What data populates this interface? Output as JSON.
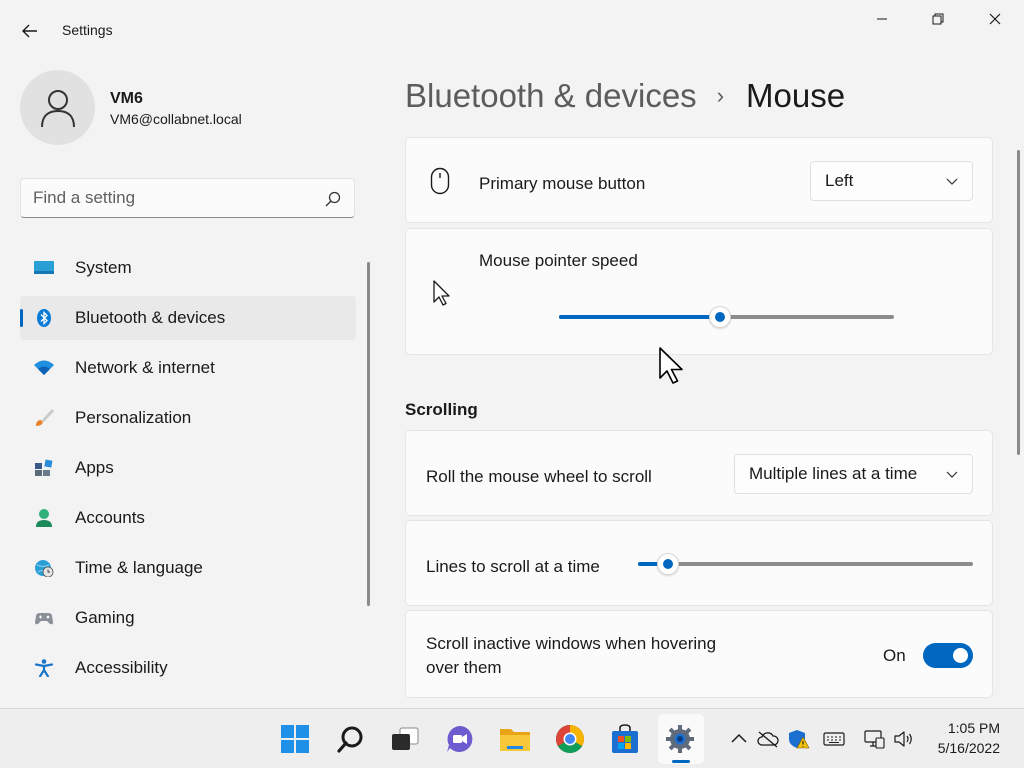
{
  "window": {
    "title": "Settings",
    "back_icon": "back-arrow-icon",
    "minimize_icon": "minimize-icon",
    "maximize_icon": "restore-icon",
    "close_icon": "close-icon"
  },
  "user": {
    "name": "VM6",
    "email": "VM6@collabnet.local",
    "avatar_icon": "person-icon"
  },
  "search": {
    "placeholder": "Find a setting",
    "icon": "search-icon"
  },
  "sidebar": {
    "items": [
      {
        "label": "System",
        "icon": "system-icon",
        "active": false
      },
      {
        "label": "Bluetooth & devices",
        "icon": "bluetooth-icon",
        "active": true
      },
      {
        "label": "Network & internet",
        "icon": "wifi-icon",
        "active": false
      },
      {
        "label": "Personalization",
        "icon": "brush-icon",
        "active": false
      },
      {
        "label": "Apps",
        "icon": "apps-icon",
        "active": false
      },
      {
        "label": "Accounts",
        "icon": "accounts-icon",
        "active": false
      },
      {
        "label": "Time & language",
        "icon": "globe-clock-icon",
        "active": false
      },
      {
        "label": "Gaming",
        "icon": "gamepad-icon",
        "active": false
      },
      {
        "label": "Accessibility",
        "icon": "accessibility-icon",
        "active": false
      }
    ]
  },
  "breadcrumb": {
    "parent": "Bluetooth & devices",
    "separator": "›",
    "current": "Mouse"
  },
  "settings": {
    "primary_button": {
      "label": "Primary mouse button",
      "value": "Left",
      "icon": "mouse-icon"
    },
    "pointer_speed": {
      "label": "Mouse pointer speed",
      "value_fraction": 0.48,
      "icon": "pointer-icon"
    },
    "scrolling_header": "Scrolling",
    "roll_wheel": {
      "label": "Roll the mouse wheel to scroll",
      "value": "Multiple lines at a time"
    },
    "lines_to_scroll": {
      "label": "Lines to scroll at a time",
      "value_fraction": 0.09
    },
    "scroll_inactive": {
      "label_line1": "Scroll inactive windows when hovering",
      "label_line2": "over them",
      "state_label": "On",
      "enabled": true
    }
  },
  "taskbar": {
    "apps": [
      "start-icon",
      "search-icon",
      "task-view-icon",
      "chat-icon",
      "file-explorer-icon",
      "chrome-icon",
      "store-icon",
      "settings-icon"
    ],
    "active_app": "settings-icon",
    "tray": [
      "chevron-up-icon",
      "onedrive-icon",
      "security-warning-icon",
      "keyboard-icon",
      "network-icon",
      "volume-icon"
    ],
    "time": "1:05 PM",
    "date": "5/16/2022"
  },
  "colors": {
    "accent": "#0067c0",
    "background": "#f3f3f3",
    "card": "#fbfbfb"
  }
}
